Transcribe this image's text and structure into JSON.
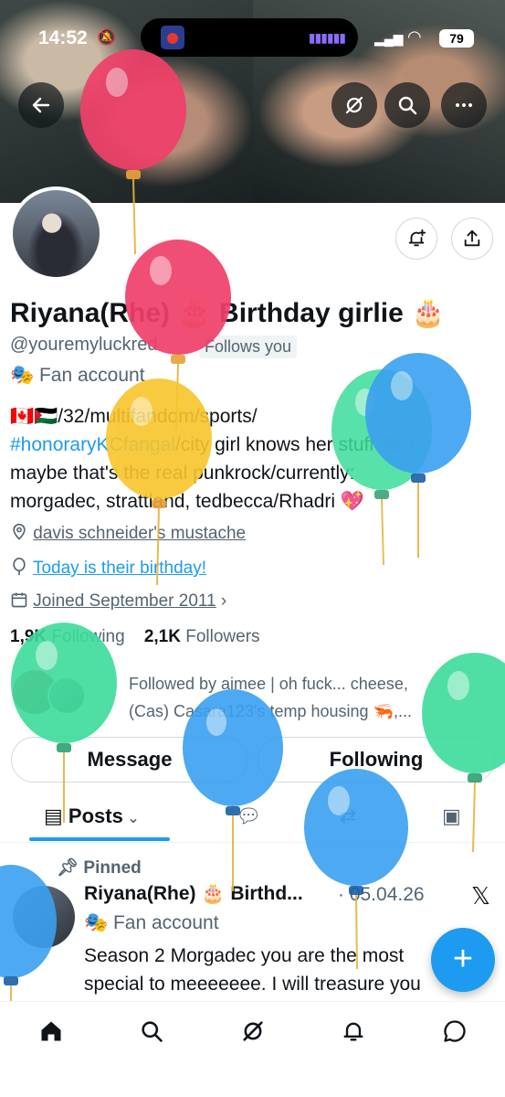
{
  "status_bar": {
    "time": "14:52",
    "battery": "79"
  },
  "header_controls": {
    "back_icon": "arrow-left-icon",
    "grok_icon": "grok-icon",
    "search_icon": "search-icon",
    "more_icon": "more-icon"
  },
  "profile": {
    "display_name": "Riyana(Rhe) 🎂 Birthday girlie 🎂",
    "handle": "@youremyluckred",
    "follows_you": "Follows you",
    "account_label": "Fan account",
    "bio_line1": "🇨🇦🇵🇸/32/multifandom/sports/",
    "bio_tag": "#honoraryKCfangal",
    "bio_line2_rest": "/city girl knows her stuff 👏 /",
    "bio_line3": "maybe that's the real punkrock/currently:",
    "bio_line4": "morgadec, strattland, tedbecca/Rhadri 💖",
    "location": "davis schneider's mustache",
    "birthday": "Today is their birthday!",
    "joined": "Joined September 2011",
    "following_count": "1,9K",
    "following_label": "Following",
    "followers_count": "2,1K",
    "followers_label": "Followers",
    "followed_by_line1": "Followed by aimee | oh fuck... cheese,",
    "followed_by_line2": "(Cas) Casara123's temp housing 🦐,..."
  },
  "actions": {
    "message": "Message",
    "following": "Following"
  },
  "tabs": {
    "posts": "Posts"
  },
  "pinned_post": {
    "pinned_label": "Pinned",
    "author": "Riyana(Rhe) 🎂 Birthd...",
    "date": "· 05.04.26",
    "account_label": "Fan account",
    "text": "Season 2 Morgadec you are the most special to meeeeeee. I will treasure you"
  },
  "colors": {
    "accent": "#1d9bf0",
    "balloon_red": "#f0406a",
    "balloon_yellow": "#f7c52c",
    "balloon_green": "#3ddc9c",
    "balloon_blue": "#3aa0f0"
  }
}
